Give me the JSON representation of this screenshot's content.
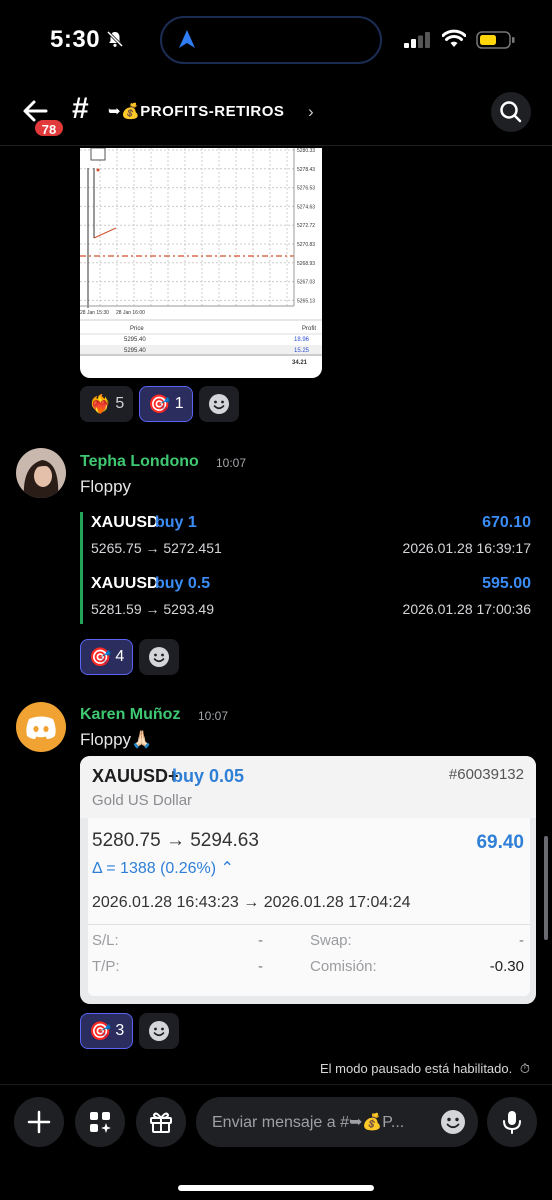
{
  "status_bar": {
    "time": "5:30"
  },
  "header": {
    "unread_badge": "78",
    "hash": "#",
    "channel_name": "➥💰PROFITS-RETIROS",
    "chevron": "›"
  },
  "chart_image": {
    "axis_prices": [
      "5280.33",
      "5278.43",
      "5276.53",
      "5274.63",
      "5272.72",
      "5270.83",
      "5268.93",
      "5267.03",
      "5265.13"
    ],
    "x_labels": [
      "28 Jan 15:30",
      "28 Jan 16:00"
    ],
    "table_headers": [
      "Price",
      "Profit"
    ],
    "rows": [
      {
        "price": "5295.40",
        "profit": "18.96"
      },
      {
        "price": "5295.40",
        "profit": "15.25"
      }
    ],
    "total": "34.21"
  },
  "reactions_1": [
    {
      "emoji": "❤️‍🔥",
      "count": "5",
      "active": false
    },
    {
      "emoji": "🎯",
      "count": "1",
      "active": true
    }
  ],
  "message_1": {
    "author": "Tepha Londono",
    "time": "10:07",
    "text": "Floppy",
    "trades": [
      {
        "symbol": "XAUUSD",
        "action": "buy 1",
        "amount": "670.10",
        "prices": "5265.75 → 5272.451",
        "date": "2026.01.28 16:39:17"
      },
      {
        "symbol": "XAUUSD",
        "action": "buy 0.5",
        "amount": "595.00",
        "prices": "5281.59 → 5293.49",
        "date": "2026.01.28 17:00:36"
      }
    ]
  },
  "reactions_2": [
    {
      "emoji": "🎯",
      "count": "4",
      "active": true
    }
  ],
  "message_2": {
    "author": "Karen Muñoz",
    "time": "10:07",
    "text": "Floppy🙏🏻"
  },
  "trade_card": {
    "symbol": "XAUUSD+",
    "action": "buy 0.05",
    "ticket": "#60039132",
    "description": "Gold US Dollar",
    "prices": "5280.75 → 5294.63",
    "profit": "69.40",
    "delta": "Δ = 1388 (0.26%) ⌃",
    "dates": "2026.01.28 16:43:23 → 2026.01.28 17:04:24",
    "sl_label": "S/L:",
    "sl_value": "-",
    "swap_label": "Swap:",
    "swap_value": "-",
    "tp_label": "T/P:",
    "tp_value": "-",
    "commission_label": "Comisión:",
    "commission_value": "-0.30"
  },
  "reactions_3": [
    {
      "emoji": "🎯",
      "count": "3",
      "active": true
    }
  ],
  "paused_notice": "El modo pausado está habilitado.",
  "composer": {
    "placeholder": "Enviar mensaje a #➥💰P..."
  },
  "colors": {
    "accent_blue": "#3b8cf5",
    "author_green": "#3fc872",
    "badge_red": "#e2393b",
    "reaction_active": "#5865f2"
  }
}
